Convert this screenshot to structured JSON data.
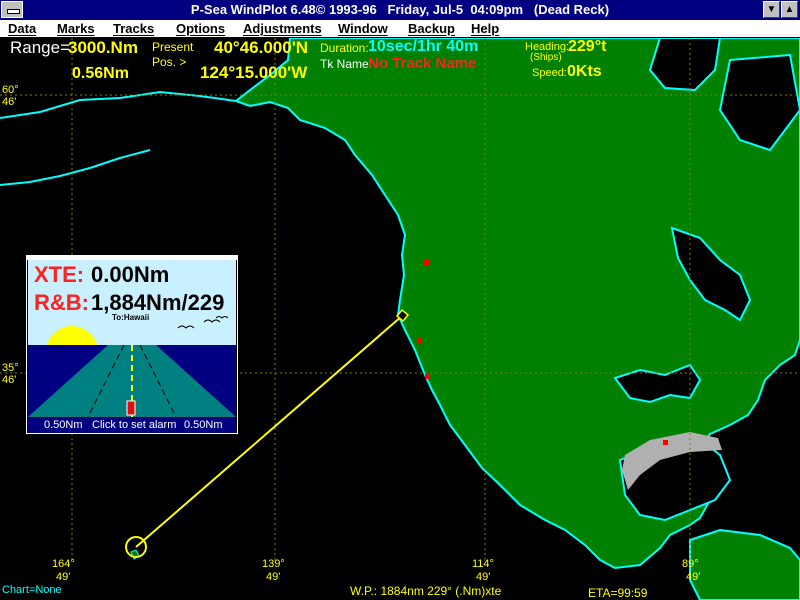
{
  "window": {
    "title": "P-Sea WindPlot 6.48© 1993-96   Friday, Jul-5  04:09pm   (Dead Reck)"
  },
  "menu": [
    "Data",
    "Marks",
    "Tracks",
    "Options",
    "Adjustments",
    "Window",
    "Backup",
    "Help"
  ],
  "hud": {
    "range_label": "Range=",
    "range_value": "3000.Nm",
    "scale_value": "0.56Nm",
    "present_label": "Present",
    "pos_label": "Pos. >",
    "lat": "40°46.000'N",
    "lon": "124°15.000'W",
    "duration_label": "Duration:",
    "duration_value": "10sec/1hr 40m",
    "track_label": "Tk Name:",
    "track_value": "No Track Name",
    "heading_label": "Heading:",
    "heading_sub": "(Ships)",
    "heading_value": "229°t",
    "speed_label": "Speed:",
    "speed_value": "0Kts"
  },
  "grid_labels": {
    "lat_60_deg": "60°",
    "lat_60_min": "46'",
    "lat_35_deg": "35°",
    "lat_35_min": "46'",
    "lon_164_deg": "164°",
    "lon_164_min": "49'",
    "lon_139_deg": "139°",
    "lon_139_min": "49'",
    "lon_114_deg": "114°",
    "lon_114_min": "49'",
    "lon_89_deg": "89°",
    "lon_89_min": "49'"
  },
  "xte_panel": {
    "xte_label": "XTE:",
    "xte_value": "0.00Nm",
    "rb_label": "R&B:",
    "rb_value": "1,884Nm/229",
    "to_label": "To:Hawaii",
    "left_scale": "0.50Nm",
    "alarm_label": "Click to set alarm",
    "right_scale": "0.50Nm"
  },
  "status": {
    "chart_label": "Chart=None",
    "waypoint": "W.P.:  1884nm 229° (.Nm)xte",
    "eta": "ETA=99:59"
  },
  "colors": {
    "land": "#008000",
    "coast": "#00ffff",
    "sea": "#000000",
    "route": "#ffff00",
    "grid": "#808000"
  }
}
